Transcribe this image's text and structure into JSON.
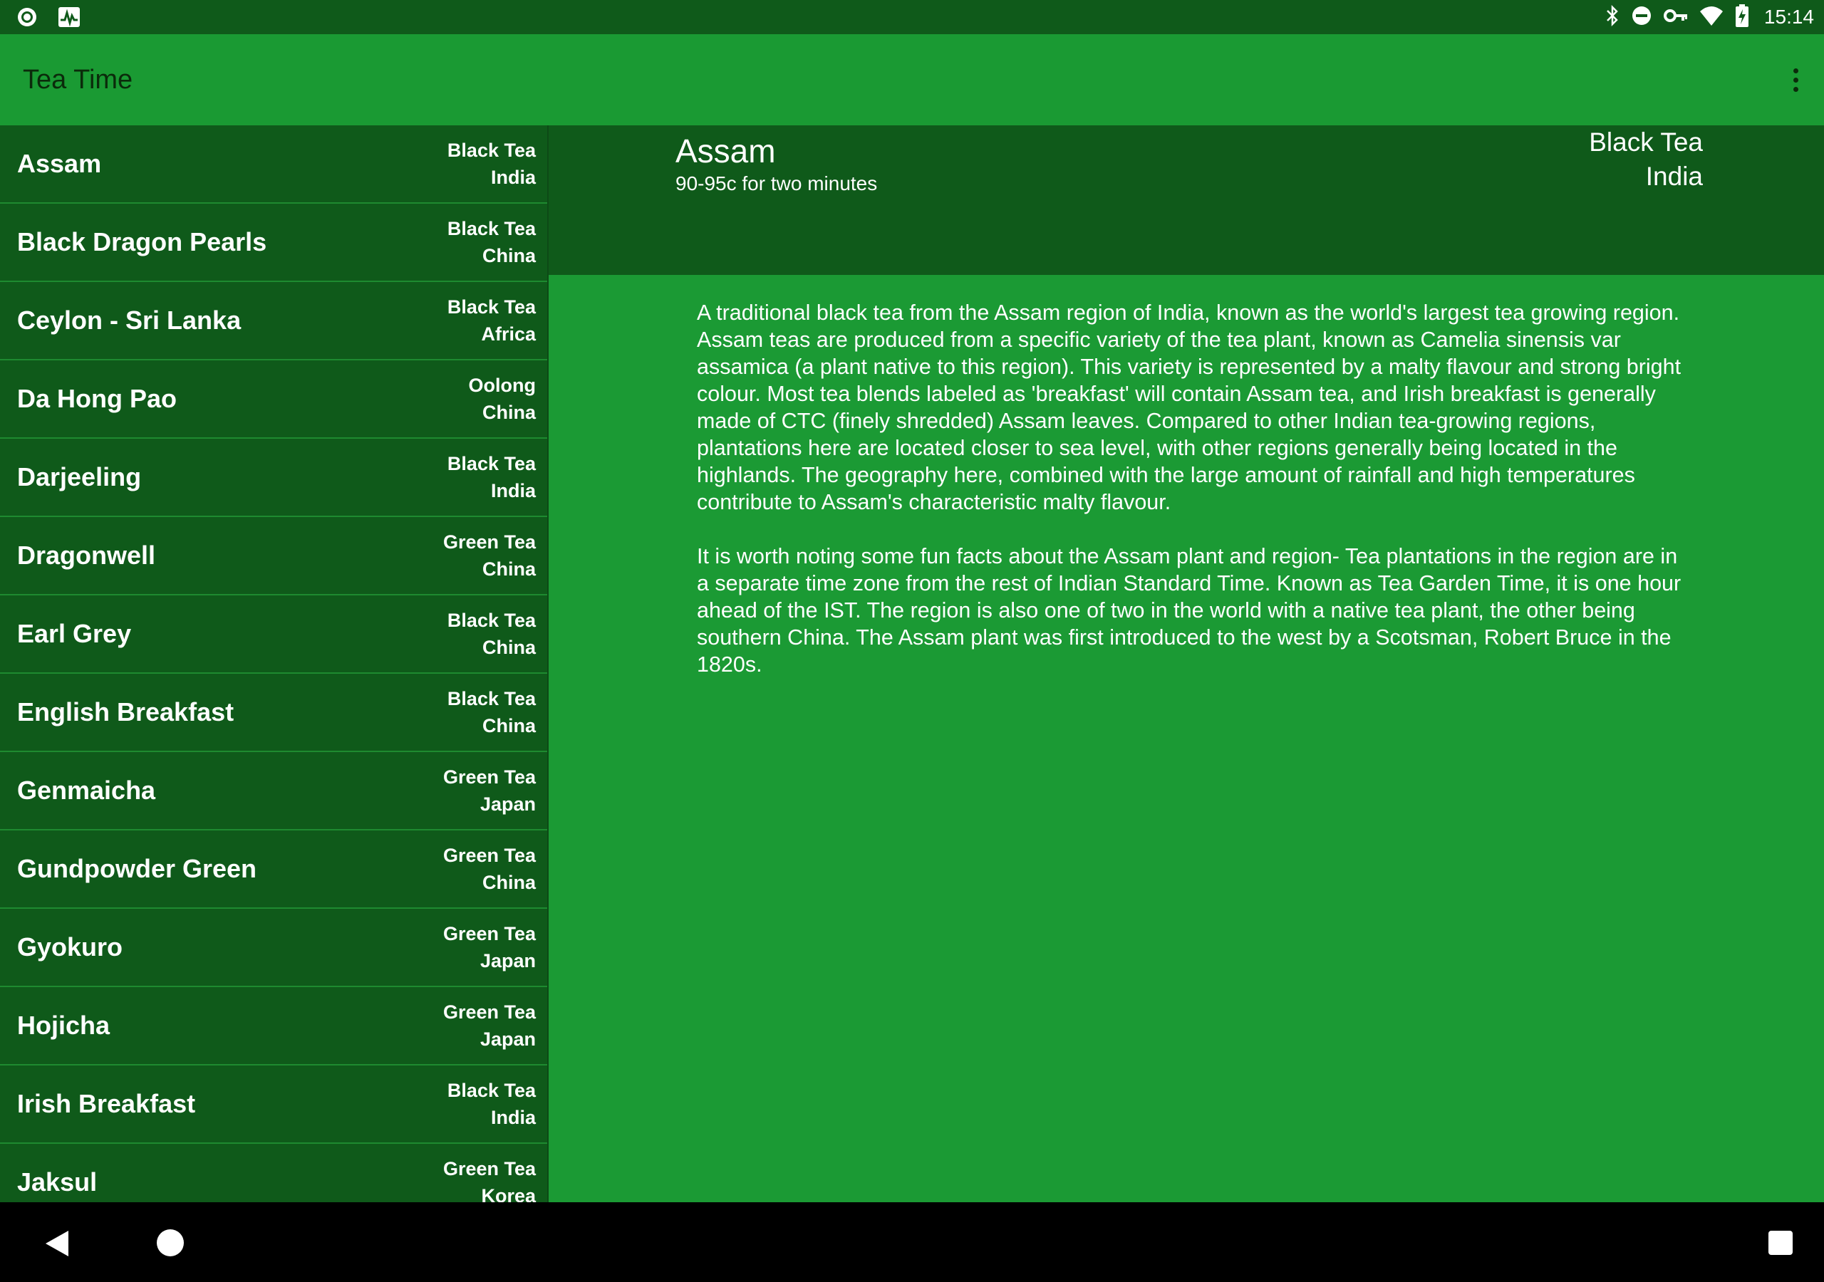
{
  "status_bar": {
    "time": "15:14",
    "left_icons": [
      "notification-circle-icon",
      "activity-graph-icon"
    ],
    "right_icons": [
      "bluetooth-icon",
      "do-not-disturb-icon",
      "vpn-key-icon",
      "wifi-icon",
      "battery-charging-icon"
    ]
  },
  "app_bar": {
    "title": "Tea Time",
    "menu_icon": "more-vert-icon"
  },
  "teas": [
    {
      "name": "Assam",
      "type": "Black Tea",
      "origin": "India"
    },
    {
      "name": "Black Dragon Pearls",
      "type": "Black Tea",
      "origin": "China"
    },
    {
      "name": "Ceylon - Sri Lanka",
      "type": "Black Tea",
      "origin": "Africa"
    },
    {
      "name": "Da Hong Pao",
      "type": "Oolong",
      "origin": "China"
    },
    {
      "name": "Darjeeling",
      "type": "Black Tea",
      "origin": "India"
    },
    {
      "name": "Dragonwell",
      "type": "Green Tea",
      "origin": "China"
    },
    {
      "name": "Earl Grey",
      "type": "Black Tea",
      "origin": "China"
    },
    {
      "name": "English Breakfast",
      "type": "Black Tea",
      "origin": "China"
    },
    {
      "name": "Genmaicha",
      "type": "Green Tea",
      "origin": "Japan"
    },
    {
      "name": "Gundpowder Green",
      "type": "Green Tea",
      "origin": "China"
    },
    {
      "name": "Gyokuro",
      "type": "Green Tea",
      "origin": "Japan"
    },
    {
      "name": "Hojicha",
      "type": "Green Tea",
      "origin": "Japan"
    },
    {
      "name": "Irish Breakfast",
      "type": "Black Tea",
      "origin": "India"
    },
    {
      "name": "Jaksul",
      "type": "Green Tea",
      "origin": "Korea"
    }
  ],
  "detail": {
    "name": "Assam",
    "brew": "90-95c for two minutes",
    "type": "Black Tea",
    "origin": "India",
    "paragraphs": [
      "A traditional black tea from the Assam region of India, known as the world's largest tea growing region. Assam teas are produced from a specific variety of the tea plant, known as Camelia sinensis var assamica (a plant native to this region). This variety is represented by a malty flavour and strong bright colour. Most tea blends labeled as 'breakfast' will contain Assam tea, and Irish breakfast is generally made of CTC (finely shredded) Assam leaves. Compared to other Indian tea-growing regions, plantations here are located closer to sea level, with other regions generally being located in the highlands. The geography here, combined with the large amount of rainfall and high temperatures contribute to Assam's characteristic malty flavour.",
      "It is worth noting some fun facts about the Assam plant and region- Tea plantations in the region are in a separate time zone from the rest of Indian Standard Time. Known as Tea Garden Time, it is one hour ahead of the IST. The region is also one of two in the world with a native tea plant, the other being southern China. The Assam plant was first introduced to the west by a Scotsman, Robert Bruce in the 1820s."
    ]
  },
  "nav_bar": {
    "buttons": [
      "back-icon",
      "home-icon",
      "recents-icon"
    ]
  },
  "colors": {
    "status_bar": "#0f5a1a",
    "app_bar": "#1a9a33",
    "list_background": "#0f5a1a",
    "detail_body": "#1b9a34"
  }
}
